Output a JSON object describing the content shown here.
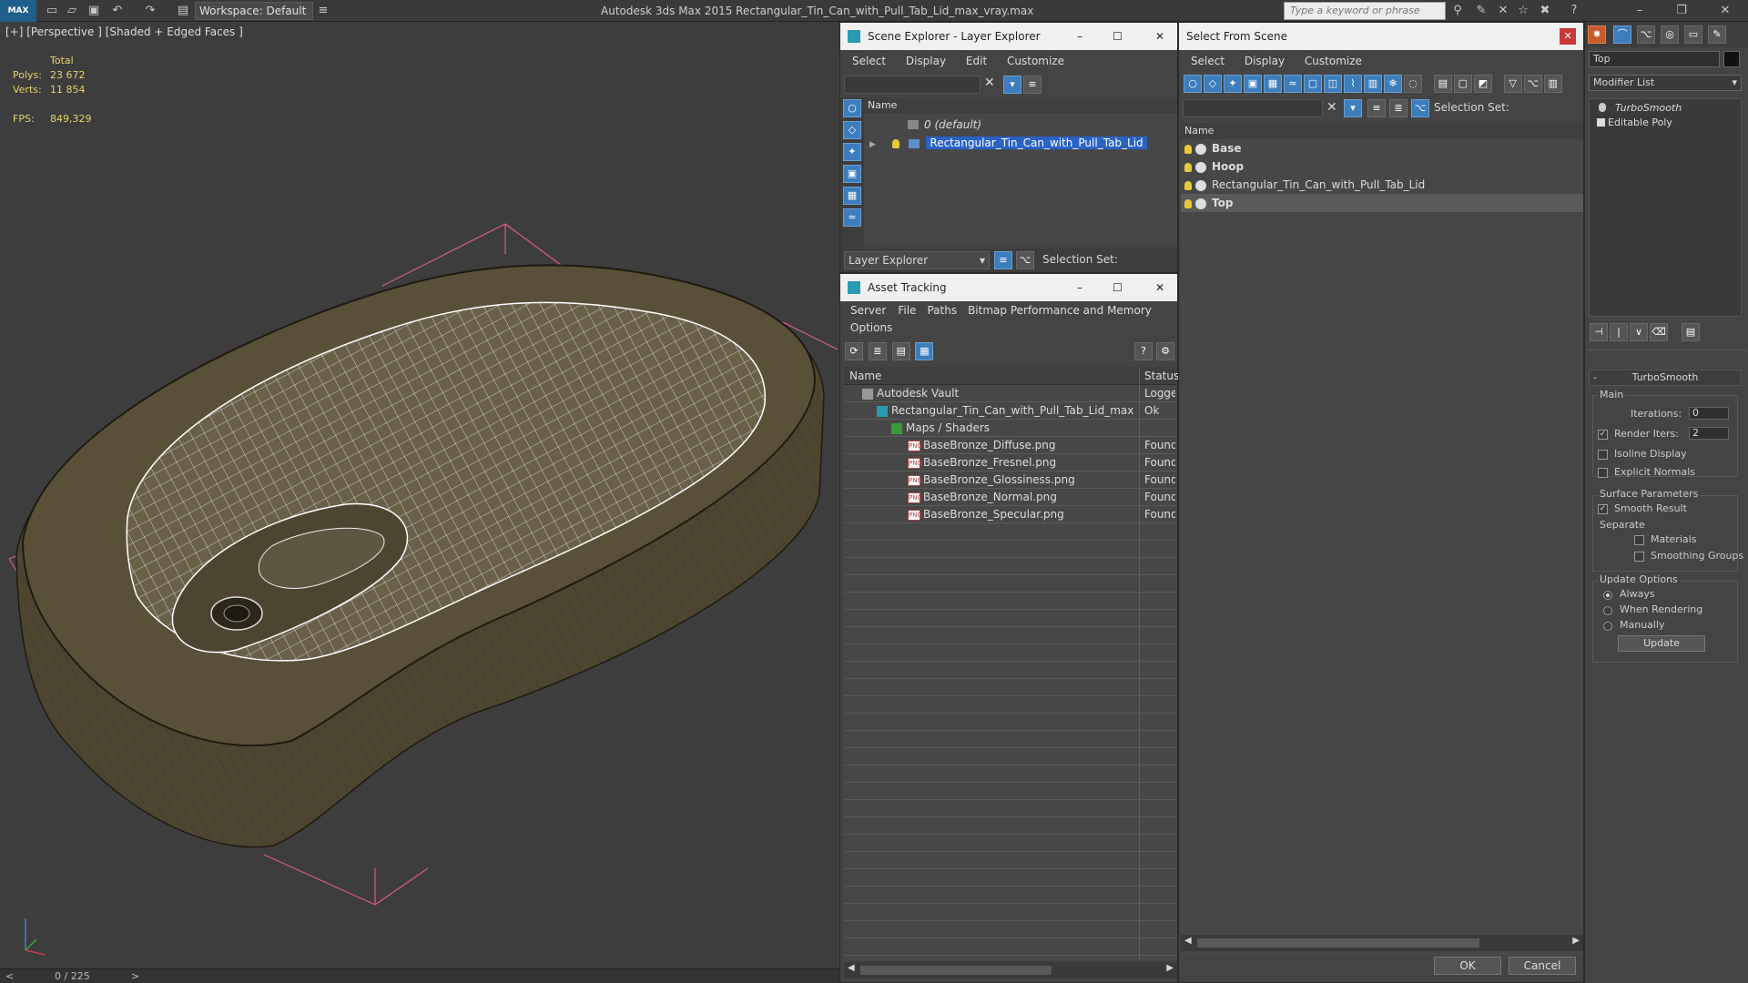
{
  "app": {
    "logo": "MAX",
    "workspace": "Workspace: Default",
    "title": "Autodesk 3ds Max  2015      Rectangular_Tin_Can_with_Pull_Tab_Lid_max_vray.max",
    "search_placeholder": "Type a keyword or phrase"
  },
  "viewport": {
    "label": "[+] [Perspective ] [Shaded + Edged Faces ]",
    "stats_title": "Total",
    "polys_label": "Polys:",
    "polys_value": "23 672",
    "verts_label": "Verts:",
    "verts_value": "11 854",
    "fps_label": "FPS:",
    "fps_value": "849,329"
  },
  "timeline": {
    "frame": "0 / 225",
    "prev": "<",
    "next": ">"
  },
  "scene_explorer": {
    "title": "Scene Explorer - Layer Explorer",
    "menu": [
      "Select",
      "Display",
      "Edit",
      "Customize"
    ],
    "col_name": "Name",
    "rows": [
      "0 (default)",
      "Rectangular_Tin_Can_with_Pull_Tab_Lid"
    ],
    "footer_mode": "Layer Explorer",
    "selection_set": "Selection Set:"
  },
  "asset_tracking": {
    "title": "Asset Tracking",
    "menu": [
      "Server",
      "File",
      "Paths",
      "Bitmap Performance and Memory",
      "Options"
    ],
    "col_name": "Name",
    "col_status": "Status",
    "rows": [
      {
        "name": "Autodesk Vault",
        "status": "Logge"
      },
      {
        "name": "Rectangular_Tin_Can_with_Pull_Tab_Lid_max_vra...",
        "status": "Ok"
      },
      {
        "name": "Maps / Shaders",
        "status": ""
      },
      {
        "name": "BaseBronze_Diffuse.png",
        "status": "Found"
      },
      {
        "name": "BaseBronze_Fresnel.png",
        "status": "Found"
      },
      {
        "name": "BaseBronze_Glossiness.png",
        "status": "Found"
      },
      {
        "name": "BaseBronze_Normal.png",
        "status": "Found"
      },
      {
        "name": "BaseBronze_Specular.png",
        "status": "Found"
      }
    ]
  },
  "select_from_scene": {
    "title": "Select From Scene",
    "menu": [
      "Select",
      "Display",
      "Customize"
    ],
    "selection_set": "Selection Set:",
    "col_name": "Name",
    "rows": [
      "Base",
      "Hoop",
      "Rectangular_Tin_Can_with_Pull_Tab_Lid",
      "Top"
    ],
    "ok": "OK",
    "cancel": "Cancel"
  },
  "command_panel": {
    "object_name": "Top",
    "modifier_list": "Modifier List",
    "stack": [
      "TurboSmooth",
      "Editable Poly"
    ],
    "rollout_title": "TurboSmooth",
    "main": "Main",
    "iterations_label": "Iterations:",
    "iterations_value": "0",
    "render_iters_label": "Render Iters:",
    "render_iters_value": "2",
    "isoline": "Isoline Display",
    "explicit_normals": "Explicit Normals",
    "surface_params": "Surface Parameters",
    "smooth_result": "Smooth Result",
    "separate": "Separate",
    "materials": "Materials",
    "smoothing_groups": "Smoothing Groups",
    "update_options": "Update Options",
    "always": "Always",
    "when_rendering": "When Rendering",
    "manually": "Manually",
    "update_button": "Update"
  },
  "colors": {
    "selection": "#2a62c6",
    "bulb": "#e8c93a",
    "viewport_bg": "#3d3d3d"
  }
}
